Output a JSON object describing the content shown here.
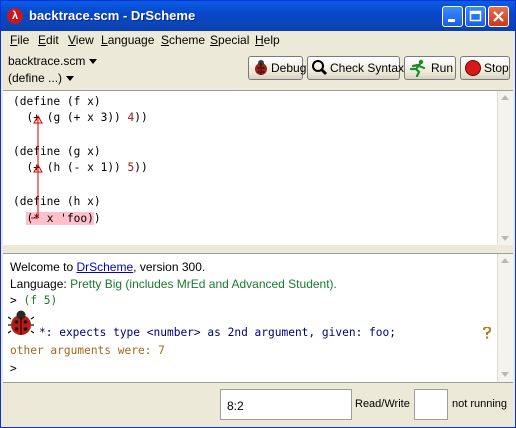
{
  "window": {
    "title": "backtrace.scm - DrScheme",
    "app_icon_glyph": "λ",
    "controls": [
      "minimize-icon",
      "maximize-icon",
      "close-icon"
    ]
  },
  "menu": [
    "File",
    "Edit",
    "View",
    "Language",
    "Scheme",
    "Special",
    "Help"
  ],
  "toolbar": {
    "file_label": "backtrace.scm",
    "define_label": "(define ...)",
    "debug_label": "Debug",
    "check_syntax_label": "Check Syntax",
    "run_label": "Run",
    "stop_label": "Stop"
  },
  "editor": {
    "lines": [
      [
        "(define (f x)"
      ],
      [
        "  (",
        "+",
        " (g (+ x 3)) ",
        "4",
        "))"
      ],
      [
        ""
      ],
      [
        "(define (g x)"
      ],
      [
        "  (",
        "+",
        " (h (- x 1)) ",
        "5",
        "))"
      ],
      [
        ""
      ],
      [
        "(define (h x)"
      ],
      [
        "  (* x 'foo))"
      ]
    ],
    "error_highlight": "(* x 'foo)"
  },
  "repl": {
    "welcome_prefix": "Welcome to ",
    "welcome_link": "DrScheme",
    "welcome_suffix": ", version 300.",
    "language_prefix": "Language: ",
    "language_name": "Pretty Big (includes MrEd and Advanced Student).",
    "prompt": ">",
    "input": "(f 5)",
    "error_message": "*: expects type <number> as 2nd argument, given: foo;",
    "error_other": "other arguments were: 7",
    "prompt2": ">"
  },
  "status": {
    "position": "8:2",
    "mode": "Read/Write",
    "running": "not running"
  },
  "colors": {
    "titlebar": "#0a5ee6",
    "highlight": "#ffc0cb",
    "error_text": "#a8661a",
    "language_text": "#1a7a2e",
    "link": "#0000cc"
  }
}
